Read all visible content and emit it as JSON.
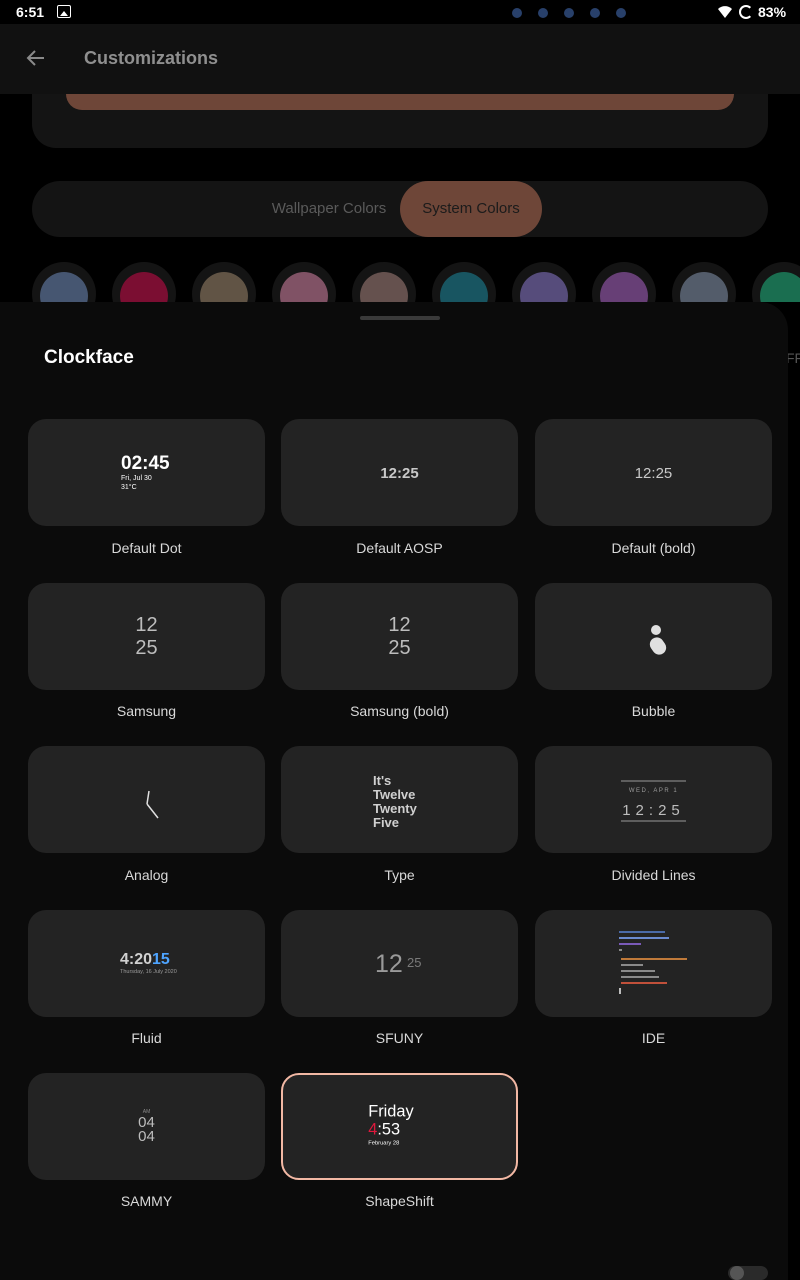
{
  "status_bar": {
    "time": "6:51",
    "battery": "83%"
  },
  "app_bar": {
    "title": "Customizations"
  },
  "color_tabs": {
    "wallpaper": "Wallpaper Colors",
    "system": "System Colors"
  },
  "swatch_colors": [
    "#6f8dbe",
    "#cf0a4a",
    "#a0896e",
    "#d985a8",
    "#a7847d",
    "#1b8aa0",
    "#8c7ad0",
    "#ab63c6",
    "#8697b0",
    "#1fb882"
  ],
  "sheet": {
    "title": "Clockface",
    "options": [
      {
        "label": "Default Dot",
        "preview": {
          "time": "02:45",
          "date": "Fri, Jul 30",
          "temp": "31°C"
        }
      },
      {
        "label": "Default AOSP",
        "preview": {
          "time": "12:25"
        }
      },
      {
        "label": "Default (bold)",
        "preview": {
          "time": "12:25"
        }
      },
      {
        "label": "Samsung",
        "preview": {
          "hour": "12",
          "minute": "25"
        }
      },
      {
        "label": "Samsung (bold)",
        "preview": {
          "hour": "12",
          "minute": "25"
        }
      },
      {
        "label": "Bubble",
        "preview": {}
      },
      {
        "label": "Analog",
        "preview": {}
      },
      {
        "label": "Type",
        "preview": {
          "lines": [
            "It's",
            "Twelve",
            "Twenty",
            "Five"
          ]
        }
      },
      {
        "label": "Divided Lines",
        "preview": {
          "date": "WED, APR 1",
          "time": "12:25"
        }
      },
      {
        "label": "Fluid",
        "preview": {
          "time_main": "4:20",
          "time_accent": "15",
          "date": "Thursday, 16 July 2020"
        }
      },
      {
        "label": "SFUNY",
        "preview": {
          "hour": "12",
          "minute": "25"
        }
      },
      {
        "label": "IDE",
        "preview": {}
      },
      {
        "label": "SAMMY",
        "preview": {
          "ampm": "AM",
          "hour": "04",
          "minute": "04"
        }
      },
      {
        "label": "ShapeShift",
        "preview": {
          "day": "Friday",
          "hour": "4",
          "minute": ":53",
          "date": "February 28"
        },
        "selected": true
      }
    ]
  },
  "colors": {
    "accent": "#6e4638",
    "selection_border": "#f2b8a4",
    "fluid_accent": "#4ea4ff",
    "shapeshift_red": "#e0183c"
  }
}
